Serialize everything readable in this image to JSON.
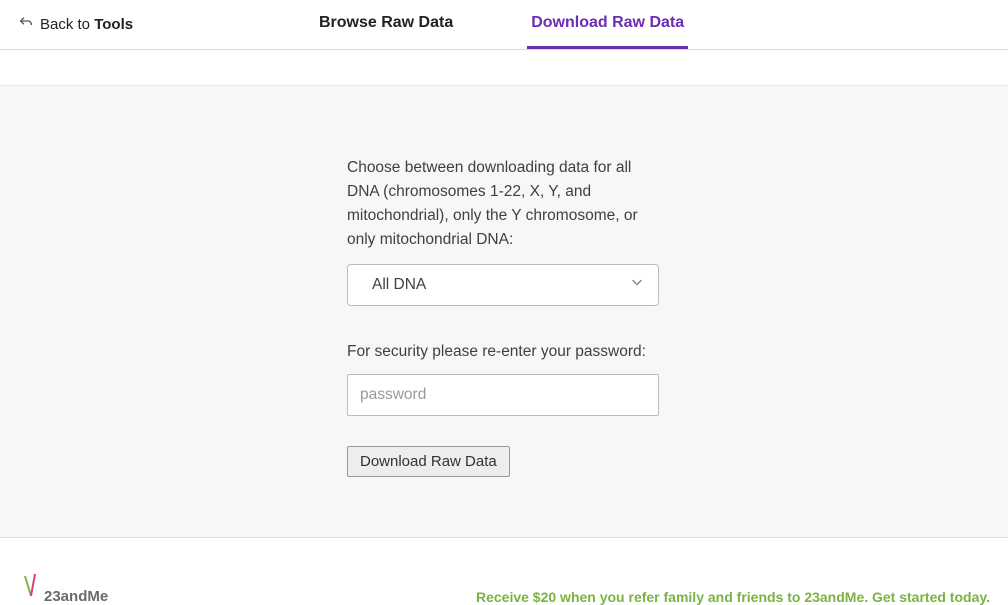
{
  "nav": {
    "back_prefix": "Back to ",
    "back_bold": "Tools",
    "tabs": {
      "browse": "Browse Raw Data",
      "download": "Download Raw Data"
    }
  },
  "form": {
    "description": "Choose between downloading data for all DNA (chromosomes 1-22, X, Y, and mitochondrial), only the Y chromosome, or only mitochondrial DNA:",
    "select_value": "All DNA",
    "password_label": "For security please re-enter your password:",
    "password_placeholder": "password",
    "download_button": "Download Raw Data"
  },
  "footer": {
    "brand": "23andMe",
    "promo": "Receive $20 when you refer family and friends to 23andMe. Get started today."
  }
}
